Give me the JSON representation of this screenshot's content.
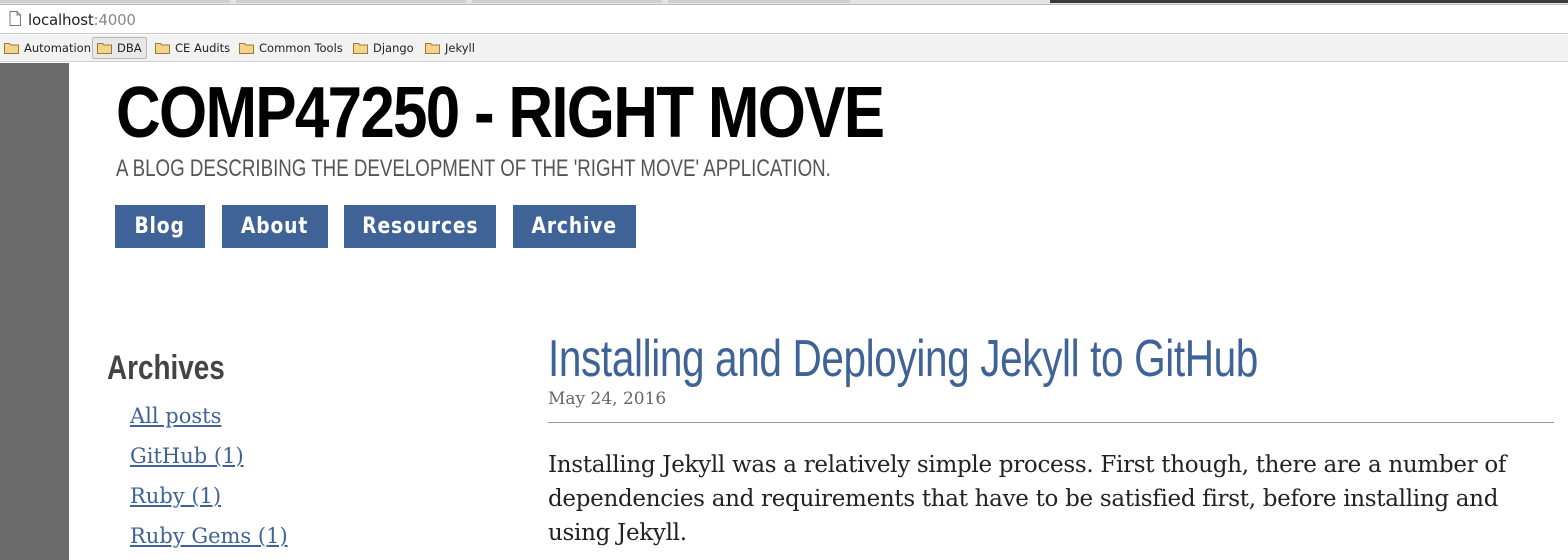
{
  "browser": {
    "url_host": "localhost",
    "url_port": ":4000",
    "bookmarks": [
      "Automation",
      "DBA",
      "CE Audits",
      "Common Tools",
      "Django",
      "Jekyll"
    ]
  },
  "site": {
    "title": "COMP47250 - RIGHT MOVE",
    "description": "A BLOG DESCRIBING THE DEVELOPMENT OF THE 'RIGHT MOVE' APPLICATION.",
    "nav": [
      "Blog",
      "About",
      "Resources",
      "Archive"
    ]
  },
  "sidebar": {
    "title": "Archives",
    "links": [
      "All posts",
      "GitHub (1)",
      "Ruby (1)",
      "Ruby Gems (1)"
    ]
  },
  "post": {
    "title": "Installing and Deploying Jekyll to GitHub",
    "date": "May 24, 2016",
    "body": "Installing Jekyll was a relatively simple process. First though, there are a number of dependencies and requirements that have to be satisfied first, before installing and using Jekyll."
  },
  "colors": {
    "accent": "#3f6396",
    "sidebar_gray": "#6b6b6b"
  }
}
